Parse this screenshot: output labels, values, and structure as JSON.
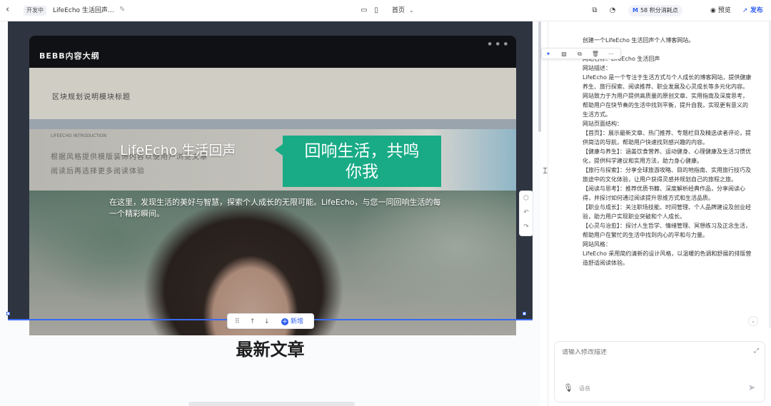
{
  "topbar": {
    "back_icon": "chevron-left-icon",
    "dev_tag": "开发中",
    "site_title": "LifeEcho 生活回声…",
    "page_selector": "首页",
    "credits_brand": "M",
    "credits_text": "58 积分消耗点",
    "preview_label": "预览",
    "publish_label": "发布"
  },
  "canvas": {
    "frame_title": "BEBB内容大纲",
    "band_text": "区块规划说明模块标题",
    "gray_small": "LIFEECHO INTRODUCTION",
    "gray_line_1": "根据风格提供模版装饰内容以便用户浏览文章",
    "gray_line_2": "阅读后再选择更多阅读体验",
    "hero_title": "LifeEcho 生活回声",
    "callout_line_1": "回响生活，共鸣",
    "callout_line_2": "你我",
    "hero_desc": "在这里，发现生活的美好与智慧，探索个人成长的无限可能。LifeEcho，与您一同回响生活的每一个精彩瞬间。",
    "toolbar_new": "新增",
    "section_heading": "最新文章"
  },
  "chat": {
    "lines": [
      "创建一个LifeEcho 生活回声个人博客网站。",
      "网站名称：LifeEcho 生活回声",
      "网站描述：",
      "LifeEcho 是一个专注于生活方式与个人成长的博客网站，提供健康养生、旅行探索、阅读推荐、职业发展及心灵成长等多元化内容。网站致力于为用户提供高质量的原创文章、实用指南及深度思考，帮助用户在快节奏的生活中找到平衡，提升自我，实现更有意义的生活方式。",
      "网站页面结构：",
      "【首页】：展示最新文章、热门推荐、专题栏目及精选读者评论，提供简洁的导航，帮助用户快速找到感兴趣的内容。",
      "【健康与养生】：涵盖饮食营养、运动健身、心理健康及生活习惯优化，提供科学建议和实用方法，助力身心健康。",
      "【旅行与探索】：分享全球旅游攻略、目的地指南、实用旅行技巧及旅途中的文化体验，让用户获得灵感并规划自己的旅程之旅。",
      "【阅读与思考】：推荐优质书籍、深度解析经典作品，分享阅读心得，并探讨如何通过阅读提升思维方式和生活品质。",
      "【职业与成长】：关注职场技能、时间管理、个人品牌建设及创业经验，助力用户实现职业突破和个人成长。",
      "【心灵与治愈】：探讨人生哲学、情绪管理、冥想练习及正念生活，帮助用户在繁忙的生活中找到内心的平和与力量。",
      "网站风格：",
      "LifeEcho 采用简约清新的设计风格，以温暖的色调和舒展的排版营造舒适阅读体验。"
    ],
    "input_placeholder": "请输入修改描述",
    "mic_label": "语音"
  }
}
